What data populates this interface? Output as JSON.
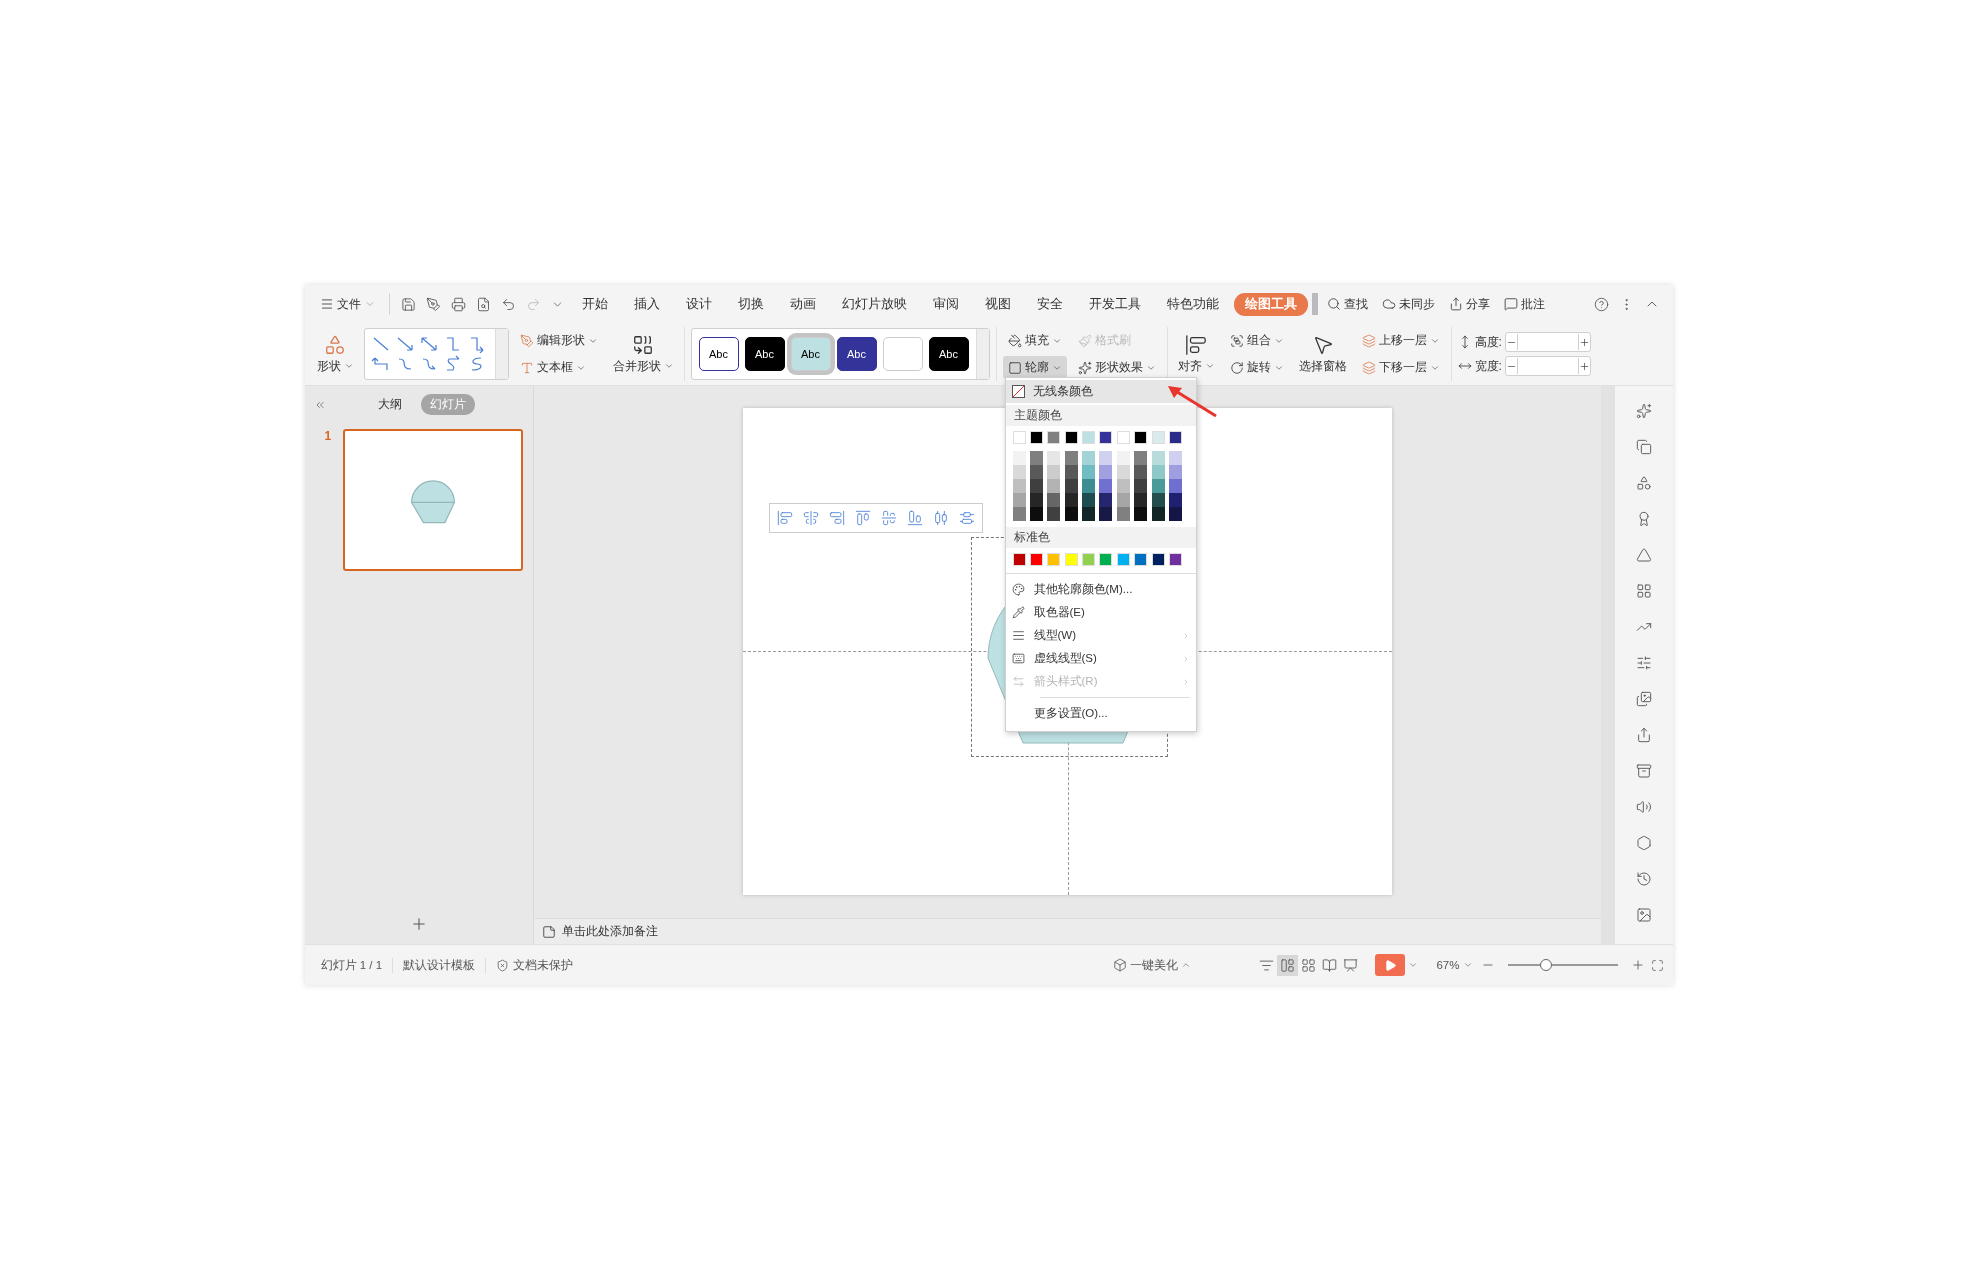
{
  "menubar": {
    "file_menu": "文件",
    "tabs": [
      {
        "label": "开始",
        "selected": false
      },
      {
        "label": "插入",
        "selected": false
      },
      {
        "label": "设计",
        "selected": false
      },
      {
        "label": "切换",
        "selected": false
      },
      {
        "label": "动画",
        "selected": false
      },
      {
        "label": "幻灯片放映",
        "selected": false
      },
      {
        "label": "审阅",
        "selected": false
      },
      {
        "label": "视图",
        "selected": false
      },
      {
        "label": "安全",
        "selected": false
      },
      {
        "label": "开发工具",
        "selected": false
      },
      {
        "label": "特色功能",
        "selected": false
      },
      {
        "label": "绘图工具",
        "selected": true
      }
    ],
    "right": [
      {
        "kind": "search",
        "label": "查找"
      },
      {
        "kind": "cloud",
        "label": "未同步"
      },
      {
        "kind": "share",
        "label": "分享"
      },
      {
        "kind": "comment",
        "label": "批注"
      }
    ]
  },
  "ribbon": {
    "shape_button": "形状",
    "edit_shape": "编辑形状",
    "text_box": "文本框",
    "merge_shapes": "合并形状",
    "styles": [
      {
        "label": "Abc",
        "color": "#ffffff",
        "selected": false
      },
      {
        "label": "Abc",
        "color": "#000000",
        "selected": false
      },
      {
        "label": "Abc",
        "color": "#bde0e3",
        "selected": true
      },
      {
        "label": "Abc",
        "color": "#333399",
        "selected": false
      },
      {
        "color": "#ffffff",
        "selected": false
      },
      {
        "label": "Abc",
        "color": "#000000",
        "selected": false
      }
    ],
    "fill": "填充",
    "format_painter": {
      "label": "格式刷",
      "disabled": true
    },
    "outline": {
      "label": "轮廓",
      "expanded": true
    },
    "shape_effects": "形状效果",
    "align": "对齐",
    "group": "组合",
    "rotate": "旋转",
    "selection_pane": "选择窗格",
    "bring_forward": "上移一层",
    "send_backward": "下移一层",
    "height_label": "高度:",
    "width_label": "宽度:"
  },
  "slides_panel": {
    "tabs": [
      {
        "label": "大纲",
        "selected": false
      },
      {
        "label": "幻灯片",
        "selected": true
      }
    ],
    "thumbnails": [
      {
        "number": "1",
        "selected": true
      }
    ]
  },
  "notes": {
    "placeholder": "单击此处添加备注"
  },
  "outline_menu": {
    "no_line": "无线条颜色",
    "theme_heading": "主题颜色",
    "theme_row": [
      {
        "color": "#ffffff"
      },
      {
        "color": "#000000"
      },
      {
        "color": "#808080"
      },
      {
        "color": "#000000"
      },
      {
        "color": "#bde0e3"
      },
      {
        "color": "#333399"
      },
      {
        "color": "#ffffff"
      },
      {
        "color": "#000000"
      },
      {
        "color": "#dbeaea"
      },
      {
        "color": "#2b2b8a"
      }
    ],
    "shades": [
      [
        {
          "color": "#f2f2f2"
        },
        {
          "color": "#7f7f7f"
        },
        {
          "color": "#e6e6e6"
        },
        {
          "color": "#7f7f7f"
        },
        {
          "color": "#a2d3d7"
        },
        {
          "color": "#d0d0f0"
        },
        {
          "color": "#f2f2f2"
        },
        {
          "color": "#7f7f7f"
        },
        {
          "color": "#b8dcdc"
        },
        {
          "color": "#cfcff0"
        }
      ],
      [
        {
          "color": "#d9d9d9"
        },
        {
          "color": "#595959"
        },
        {
          "color": "#cccccc"
        },
        {
          "color": "#595959"
        },
        {
          "color": "#71bcc2"
        },
        {
          "color": "#a0a0e0"
        },
        {
          "color": "#d9d9d9"
        },
        {
          "color": "#595959"
        },
        {
          "color": "#8ec8c8"
        },
        {
          "color": "#9f9fe0"
        }
      ],
      [
        {
          "color": "#bfbfbf"
        },
        {
          "color": "#3f3f3f"
        },
        {
          "color": "#b3b3b3"
        },
        {
          "color": "#3f3f3f"
        },
        {
          "color": "#3d8d93"
        },
        {
          "color": "#7070d0"
        },
        {
          "color": "#bfbfbf"
        },
        {
          "color": "#3f3f3f"
        },
        {
          "color": "#4a9a9a"
        },
        {
          "color": "#6f6fd0"
        }
      ],
      [
        {
          "color": "#a6a6a6"
        },
        {
          "color": "#262626"
        },
        {
          "color": "#666666"
        },
        {
          "color": "#262626"
        },
        {
          "color": "#1f4c50"
        },
        {
          "color": "#26266e"
        },
        {
          "color": "#a6a6a6"
        },
        {
          "color": "#262626"
        },
        {
          "color": "#244e4e"
        },
        {
          "color": "#202070"
        }
      ],
      [
        {
          "color": "#808080"
        },
        {
          "color": "#0d0d0d"
        },
        {
          "color": "#404040"
        },
        {
          "color": "#0d0d0d"
        },
        {
          "color": "#102628"
        },
        {
          "color": "#191947"
        },
        {
          "color": "#808080"
        },
        {
          "color": "#0d0d0d"
        },
        {
          "color": "#122626"
        },
        {
          "color": "#151548"
        }
      ]
    ],
    "standard_heading": "标准色",
    "standard": [
      {
        "color": "#c00000"
      },
      {
        "color": "#ff0000"
      },
      {
        "color": "#ffc000"
      },
      {
        "color": "#ffff00"
      },
      {
        "color": "#92d050"
      },
      {
        "color": "#00b050"
      },
      {
        "color": "#00b0f0"
      },
      {
        "color": "#0070c0"
      },
      {
        "color": "#002060"
      },
      {
        "color": "#7030a0"
      }
    ],
    "items": [
      {
        "kind": "palette",
        "label": "其他轮廓颜色(M)...",
        "disabled": false,
        "submenu": false
      },
      {
        "kind": "pipette",
        "label": "取色器(E)",
        "disabled": false,
        "submenu": false
      },
      {
        "kind": "weight",
        "label": "线型(W)",
        "disabled": false,
        "submenu": true
      },
      {
        "kind": "dash",
        "label": "虚线线型(S)",
        "disabled": false,
        "submenu": true
      },
      {
        "kind": "arrow",
        "label": "箭头样式(R)",
        "disabled": true,
        "submenu": true
      },
      {
        "kind": "plain",
        "label": "更多设置(O)...",
        "disabled": false,
        "submenu": false
      }
    ]
  },
  "status_bar": {
    "slide": "幻灯片 1 / 1",
    "template": "默认设计模板",
    "protection": "文档未保护",
    "beautify": "一键美化",
    "zoom": "67%",
    "zoom_slider": {
      "level": 0.35
    }
  }
}
